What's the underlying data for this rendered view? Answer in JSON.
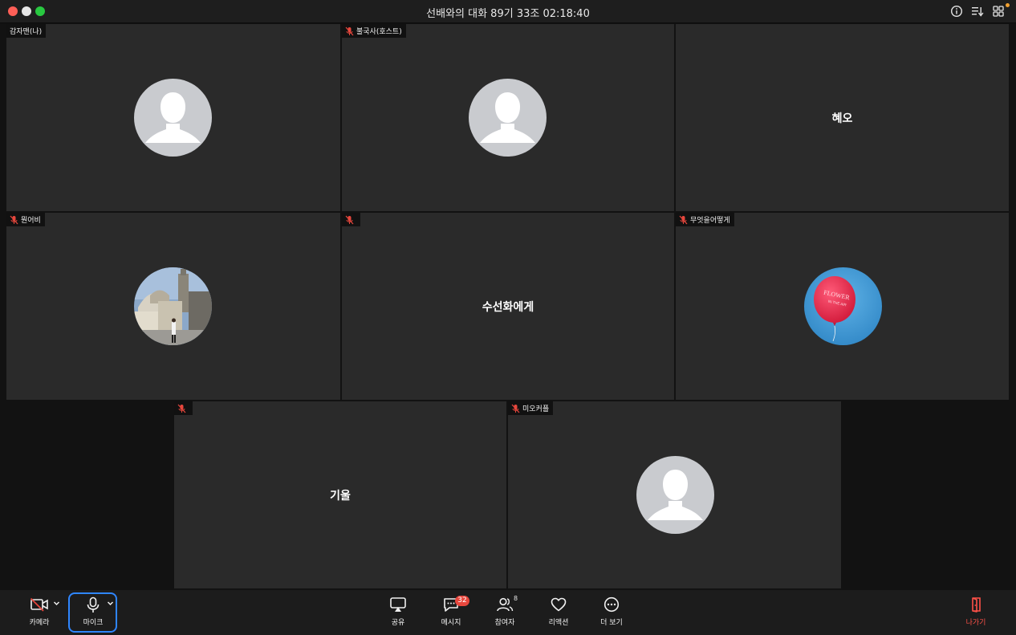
{
  "window": {
    "title": "선배와의 대화 89기 33조 02:18:40"
  },
  "tiles": [
    {
      "label": "감자맨(나)",
      "muted": false,
      "content": "default-avatar"
    },
    {
      "label": "불국사(호스트)",
      "muted": true,
      "content": "default-avatar"
    },
    {
      "label": "",
      "muted": false,
      "name": "혜오"
    },
    {
      "label": "뭔어비",
      "muted": true,
      "content": "photo-cathedral"
    },
    {
      "label": "",
      "muted": true,
      "name": "수선화에게"
    },
    {
      "label": "무엇을어떻게",
      "muted": true,
      "content": "photo-balloon"
    },
    {
      "label": "",
      "muted": true,
      "name": "기울"
    },
    {
      "label": "미오커플",
      "muted": true,
      "content": "default-avatar"
    }
  ],
  "balloon_text": {
    "line1": "FLOWER",
    "line2": "IN THE AIR"
  },
  "toolbar": {
    "camera_label": "카메라",
    "mic_label": "마이크",
    "share_label": "공유",
    "messages_label": "메시지",
    "messages_badge": "32",
    "participants_label": "참여자",
    "participants_count": "8",
    "reactions_label": "리액션",
    "more_label": "더 보기",
    "leave_label": "나가기"
  },
  "colors": {
    "accent": "#2f86ff",
    "leave": "#ff5148",
    "badge": "#e8473d",
    "mute": "#e8473d",
    "tile": "#2a2a2a"
  },
  "icons": {
    "camera": "camera-off-icon",
    "mic": "microphone-icon",
    "share": "screen-share-icon",
    "messages": "chat-bubble-icon",
    "participants": "people-icon",
    "reactions": "heart-icon",
    "more": "ellipsis-circle-icon",
    "leave": "door-exit-icon",
    "info": "info-icon",
    "sort": "sort-icon",
    "grid": "grid-view-icon"
  }
}
